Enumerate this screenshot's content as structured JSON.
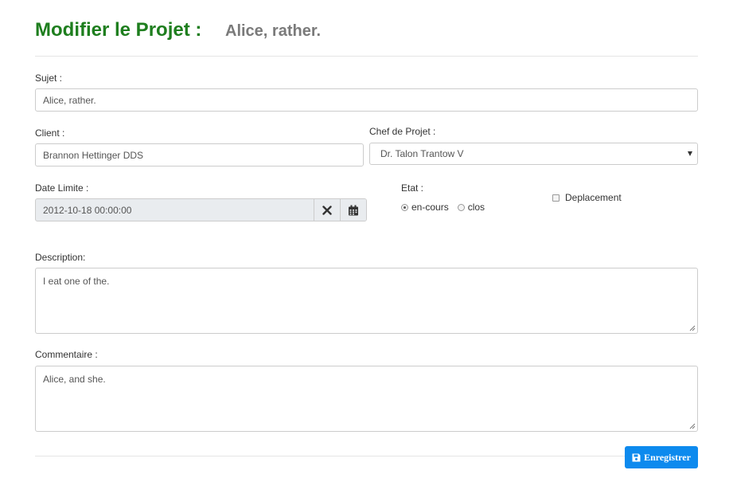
{
  "header": {
    "title": "Modifier le Projet :",
    "subject_display": "Alice, rather."
  },
  "form": {
    "sujet": {
      "label": "Sujet :",
      "value": "Alice, rather."
    },
    "client": {
      "label": "Client :",
      "value": "Brannon Hettinger DDS"
    },
    "chef_de_projet": {
      "label": "Chef de Projet :",
      "selected": "Dr. Talon Trantow V"
    },
    "date_limite": {
      "label": "Date Limite :",
      "value": "2012-10-18 00:00:00",
      "clear_icon": "times-icon",
      "calendar_icon": "calendar-icon"
    },
    "etat": {
      "label": "Etat :",
      "options": [
        "en-cours",
        "clos"
      ],
      "selected": "en-cours"
    },
    "deplacement": {
      "label": "Deplacement",
      "checked": false
    },
    "description": {
      "label": "Description:",
      "value": "I eat one of the."
    },
    "commentaire": {
      "label": "Commentaire :",
      "value": "Alice, and she."
    }
  },
  "actions": {
    "save_label": "Enregistrer",
    "save_icon": "floppy-disk-icon",
    "save_color": "#0d8aee"
  },
  "colors": {
    "title": "#1e7e1e",
    "subtitle": "#7a7a7a"
  }
}
